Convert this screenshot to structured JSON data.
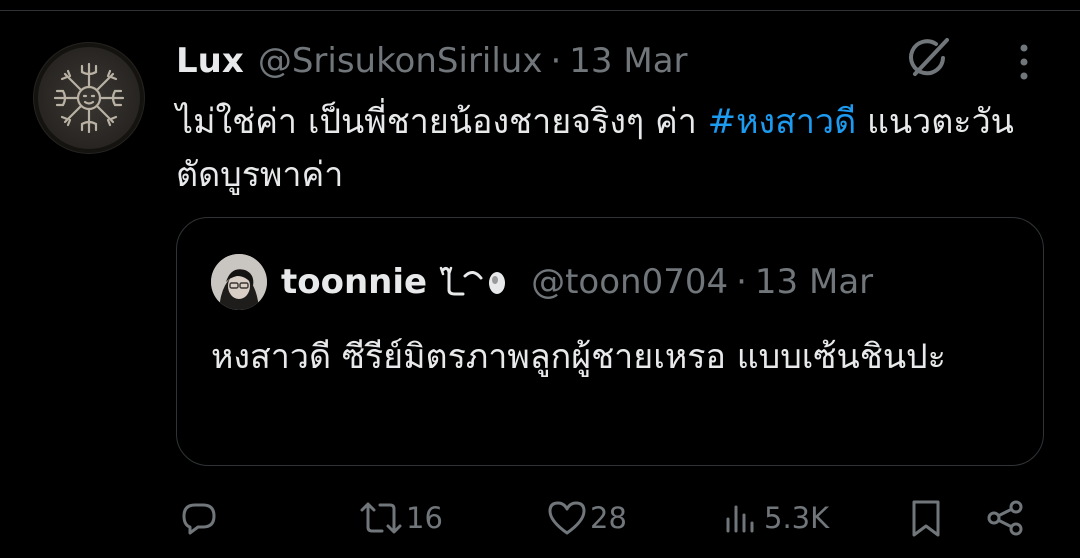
{
  "tweet": {
    "name": "Lux",
    "handle": "@SrisukonSirilux",
    "separator": "·",
    "date": "13 Mar",
    "text_before": "ไม่ใช่ค่า เป็นพี่ชายน้องชายจริงๆ ค่า ",
    "hashtag": "#หงสาวดี",
    "text_after": " แนวตะวันตัดบูรพาค่า"
  },
  "quote": {
    "name": "toonnie",
    "handle": "@toon0704",
    "separator": "·",
    "date": "13 Mar",
    "text": "หงสาวดี ซีรีย์มิตรภาพลูกผู้ชายเหรอ แบบเซ้นชินปะ"
  },
  "actions": {
    "replies": "",
    "reposts": "16",
    "likes": "28",
    "views": "5.3K"
  },
  "icons": {
    "reply": "reply-icon",
    "repost": "repost-icon",
    "like": "heart-icon",
    "views": "views-icon",
    "bookmark": "bookmark-icon",
    "share": "share-icon",
    "grok": "grok-icon",
    "more": "more-icon"
  },
  "colors": {
    "background": "#000000",
    "text": "#e7e9ea",
    "muted": "#71767b",
    "link": "#1d9bf0",
    "border": "#2f3336"
  }
}
